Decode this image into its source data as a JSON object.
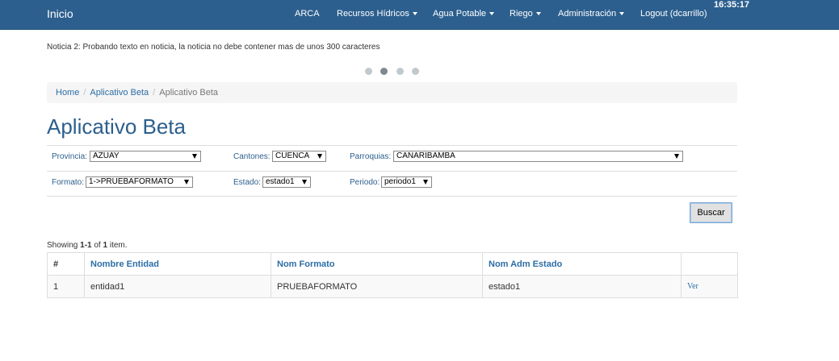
{
  "navbar": {
    "brand": "Inicio",
    "items": [
      {
        "label": "ARCA",
        "dropdown": false
      },
      {
        "label": "Recursos Hídricos",
        "dropdown": true
      },
      {
        "label": "Agua Potable",
        "dropdown": true
      },
      {
        "label": "Riego",
        "dropdown": true
      },
      {
        "label": "Administración",
        "dropdown": true
      },
      {
        "label": "Logout (dcarrillo)",
        "dropdown": false
      }
    ],
    "clock": "16:35:17"
  },
  "news": {
    "text": "Noticia 2: Probando texto en noticia, la noticia no debe contener mas de unos 300 caracteres",
    "total_slides": 4,
    "active_slide": 2
  },
  "breadcrumb": {
    "items": [
      "Home",
      "Aplicativo Beta"
    ],
    "current": "Aplicativo Beta"
  },
  "page_title": "Aplicativo Beta",
  "filters": {
    "provincia": {
      "label": "Provincia:",
      "value": "AZUAY"
    },
    "cantones": {
      "label": "Cantones:",
      "value": "CUENCA"
    },
    "parroquias": {
      "label": "Parroquias:",
      "value": "CAÑARIBAMBA"
    },
    "formato": {
      "label": "Formato:",
      "value": "1->PRUEBAFORMATO"
    },
    "estado": {
      "label": "Estado:",
      "value": "estado1"
    },
    "periodo": {
      "label": "Periodo:",
      "value": "periodo1"
    }
  },
  "search_button": "Buscar",
  "summary": {
    "prefix": "Showing ",
    "range": "1-1",
    "middle": " of ",
    "total": "1",
    "suffix": " item."
  },
  "table": {
    "columns": [
      "#",
      "Nombre Entidad",
      "Nom Formato",
      "Nom Adm Estado",
      ""
    ],
    "rows": [
      {
        "num": "1",
        "entidad": "entidad1",
        "formato": "PRUEBAFORMATO",
        "estado": "estado1",
        "action": "Ver"
      }
    ]
  },
  "colors": {
    "navbar": "#2c5f8e",
    "link": "#2c6ea6",
    "title": "#2c5f8e"
  }
}
